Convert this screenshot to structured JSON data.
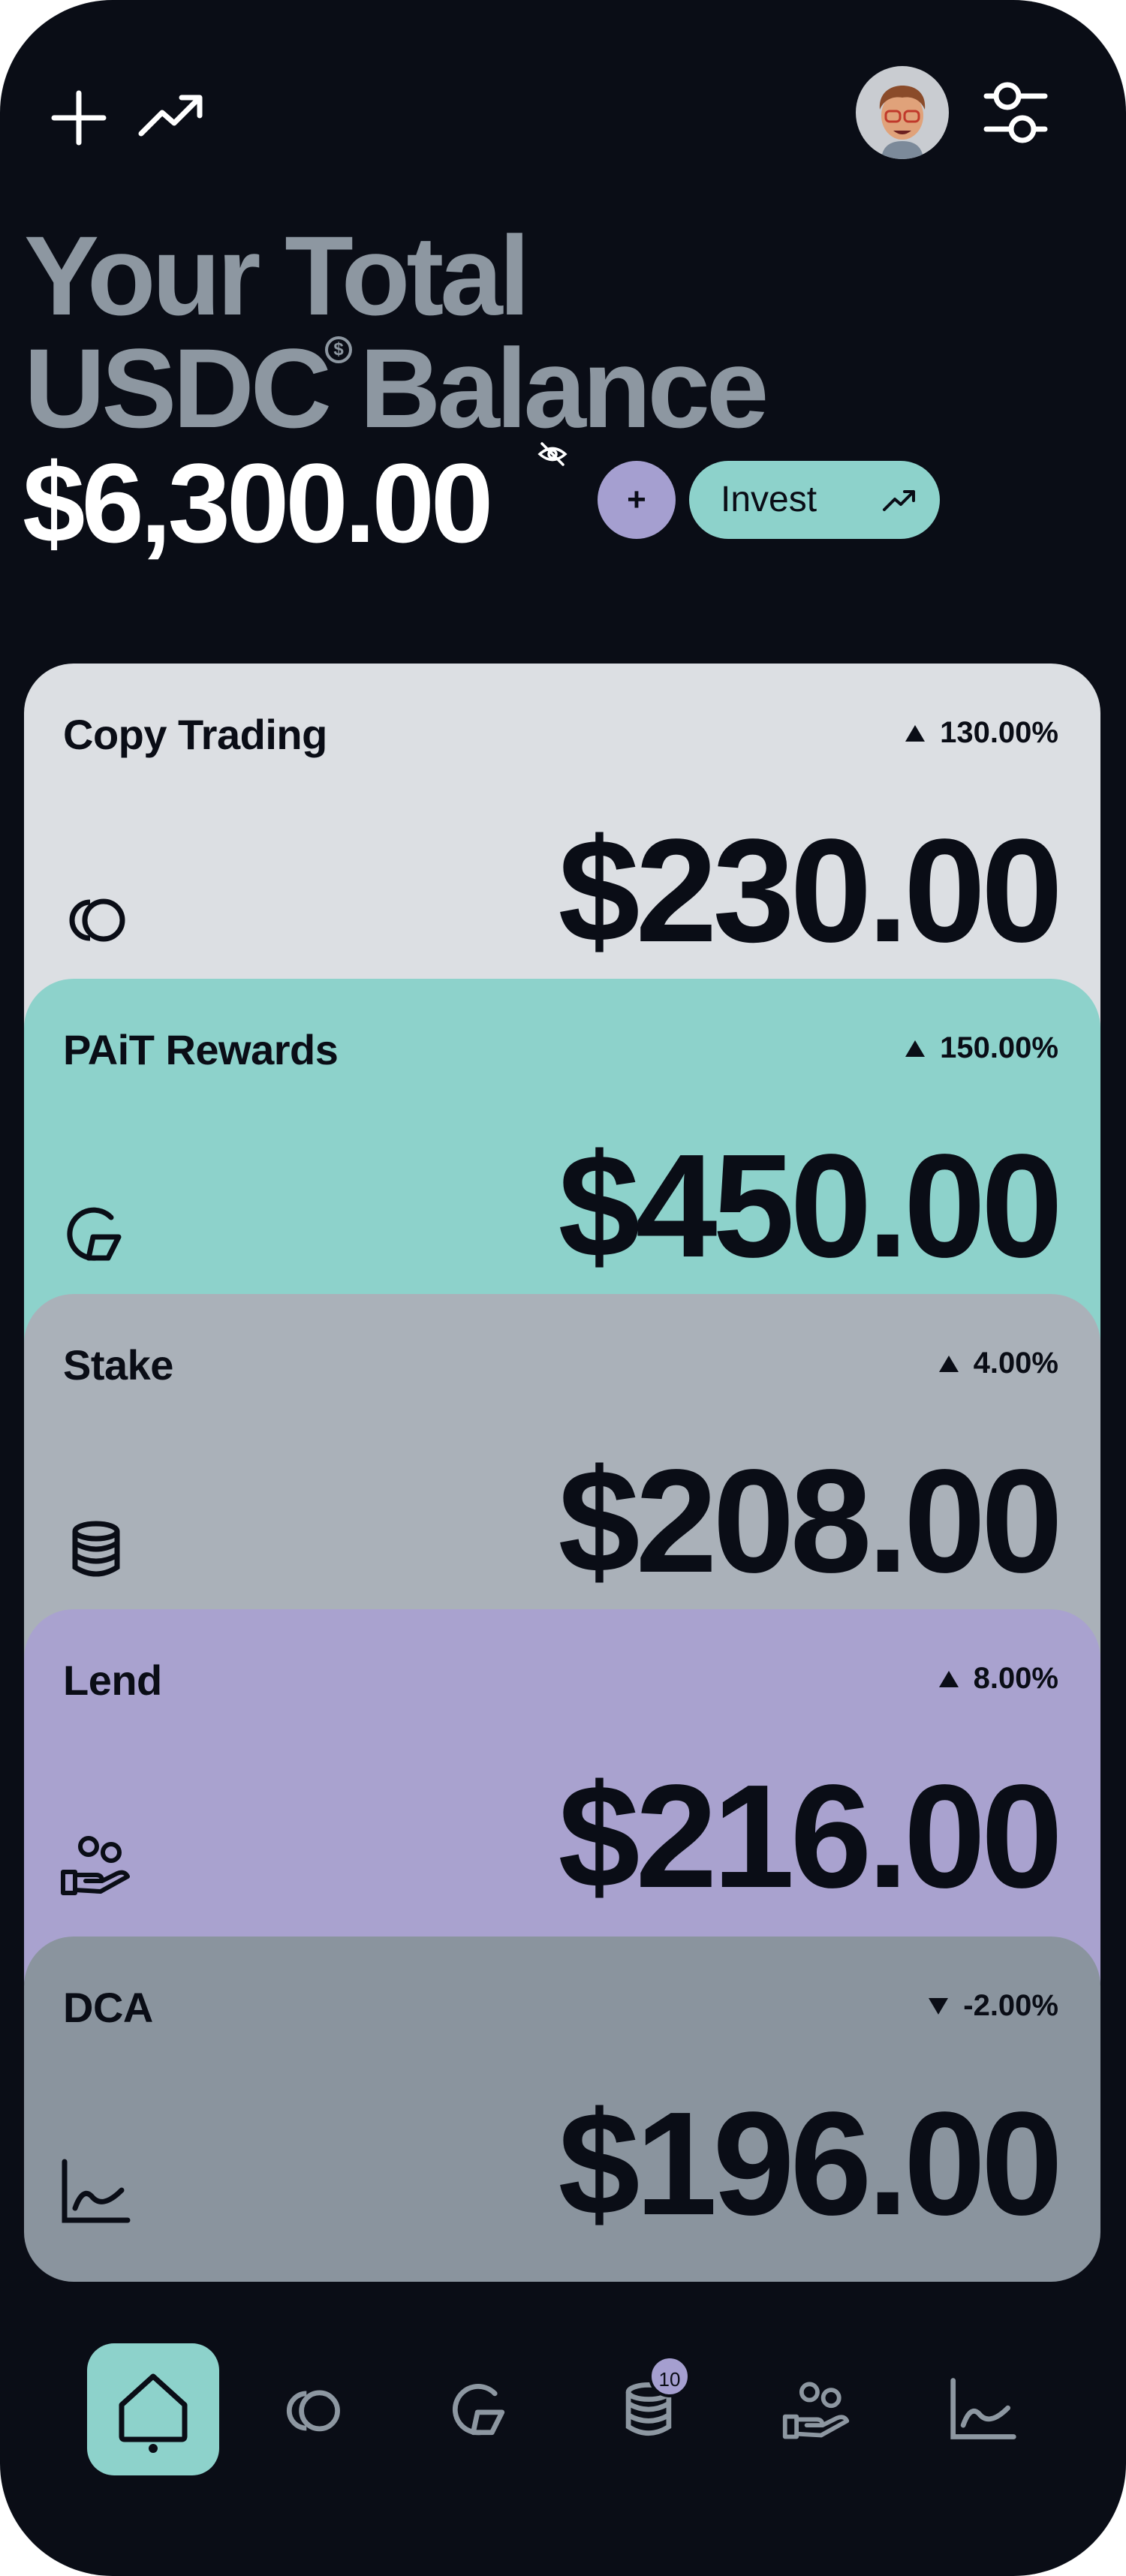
{
  "header": {
    "title_line1": "Your Total",
    "title_line2_a": "USDC",
    "title_currency_mark": "$",
    "title_line2_b": "Balance",
    "balance": "$6,300.00",
    "add_label": "+",
    "invest_label": "Invest"
  },
  "cards": [
    {
      "name": "Copy Trading",
      "change": "130.00%",
      "direction": "up",
      "amount": "$230.00",
      "color": "#dcdfe3",
      "icon": "copy-trading-icon"
    },
    {
      "name": "PAiT Rewards",
      "change": "150.00%",
      "direction": "up",
      "amount": "$450.00",
      "color": "#8dd2cb",
      "icon": "rewards-icon"
    },
    {
      "name": "Stake",
      "change": "4.00%",
      "direction": "up",
      "amount": "$208.00",
      "color": "#aab1b9",
      "icon": "stake-coins-icon"
    },
    {
      "name": "Lend",
      "change": "8.00%",
      "direction": "up",
      "amount": "$216.00",
      "color": "#a9a2cf",
      "icon": "lend-hand-icon"
    },
    {
      "name": "DCA",
      "change": "-2.00%",
      "direction": "down",
      "amount": "$196.00",
      "color": "#8a949e",
      "icon": "dca-chart-icon"
    }
  ],
  "nav": {
    "items": [
      "home-icon",
      "copy-trading-icon",
      "rewards-icon",
      "stake-coins-icon",
      "lend-hand-icon",
      "dca-chart-icon"
    ],
    "active": "home-icon",
    "stake_badge": "10"
  },
  "colors": {
    "background": "#0a0d16",
    "title_grey": "#8d97a1",
    "accent_teal": "#8dd2cb",
    "accent_purple": "#a59fd0"
  }
}
